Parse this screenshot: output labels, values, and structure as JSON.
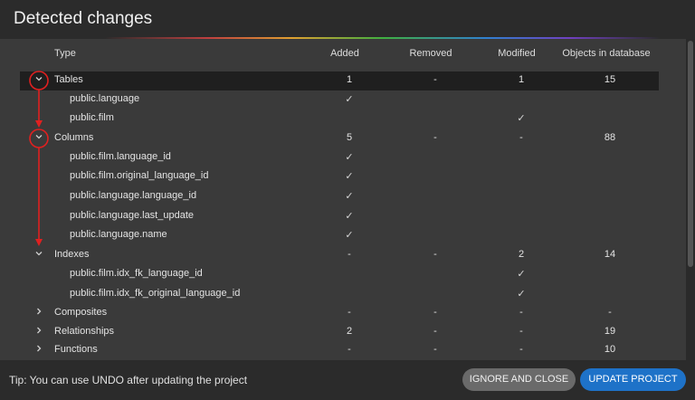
{
  "dialog": {
    "title": "Detected changes"
  },
  "columns": {
    "type": "Type",
    "added": "Added",
    "removed": "Removed",
    "modified": "Modified",
    "objects": "Objects in database"
  },
  "rows": [
    {
      "name": "Tables",
      "level": 0,
      "expanded": true,
      "selected": true,
      "added": "1",
      "removed": "-",
      "modified": "1",
      "objects": "15"
    },
    {
      "name": "public.language",
      "level": 1,
      "added": "✓",
      "removed": "",
      "modified": "",
      "objects": ""
    },
    {
      "name": "public.film",
      "level": 1,
      "added": "",
      "removed": "",
      "modified": "✓",
      "objects": ""
    },
    {
      "name": "Columns",
      "level": 0,
      "expanded": true,
      "added": "5",
      "removed": "-",
      "modified": "-",
      "objects": "88"
    },
    {
      "name": "public.film.language_id",
      "level": 1,
      "added": "✓",
      "removed": "",
      "modified": "",
      "objects": ""
    },
    {
      "name": "public.film.original_language_id",
      "level": 1,
      "added": "✓",
      "removed": "",
      "modified": "",
      "objects": ""
    },
    {
      "name": "public.language.language_id",
      "level": 1,
      "added": "✓",
      "removed": "",
      "modified": "",
      "objects": ""
    },
    {
      "name": "public.language.last_update",
      "level": 1,
      "added": "✓",
      "removed": "",
      "modified": "",
      "objects": ""
    },
    {
      "name": "public.language.name",
      "level": 1,
      "added": "✓",
      "removed": "",
      "modified": "",
      "objects": ""
    },
    {
      "name": "Indexes",
      "level": 0,
      "expanded": true,
      "added": "-",
      "removed": "-",
      "modified": "2",
      "objects": "14"
    },
    {
      "name": "public.film.idx_fk_language_id",
      "level": 1,
      "added": "",
      "removed": "",
      "modified": "✓",
      "objects": ""
    },
    {
      "name": "public.film.idx_fk_original_language_id",
      "level": 1,
      "added": "",
      "removed": "",
      "modified": "✓",
      "objects": ""
    },
    {
      "name": "Composites",
      "level": 0,
      "expanded": false,
      "added": "-",
      "removed": "-",
      "modified": "-",
      "objects": "-"
    },
    {
      "name": "Relationships",
      "level": 0,
      "expanded": false,
      "added": "2",
      "removed": "-",
      "modified": "-",
      "objects": "19"
    },
    {
      "name": "Functions",
      "level": 0,
      "expanded": false,
      "added": "-",
      "removed": "-",
      "modified": "-",
      "objects": "10"
    }
  ],
  "icons": {
    "expanded": "chevron-down-icon",
    "collapsed": "chevron-right-icon",
    "check": "check-icon"
  },
  "footer": {
    "tip": "Tip: You can use UNDO after updating the project",
    "ignore_label": "IGNORE AND CLOSE",
    "update_label": "UPDATE PROJECT"
  },
  "colors": {
    "accent": "#1e72c8",
    "annotation": "#e02020",
    "selected_row": "#1f1f1f"
  }
}
